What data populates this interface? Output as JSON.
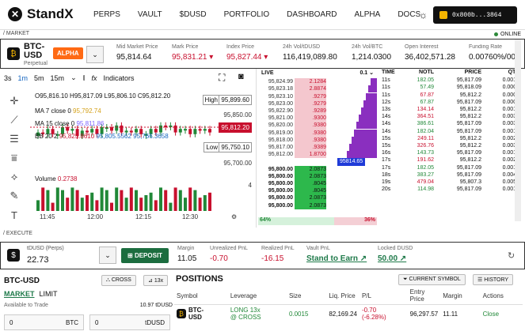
{
  "nav": {
    "logo": "StandX",
    "items": [
      "PERPS",
      "VAULT",
      "$DUSD",
      "PORTFOLIO",
      "DASHBOARD",
      "ALPHA",
      "DOCS"
    ],
    "wallet": "0x800b...3864"
  },
  "sections": {
    "market": "/ MARKET",
    "online": "ONLINE",
    "execute": "/ EXECUTE"
  },
  "ticker": {
    "symbol": "BTC-USD",
    "type": "Perpetual",
    "badge": "ALPHA",
    "stats": [
      {
        "k": "Mid Market Price",
        "v": "95,814.64"
      },
      {
        "k": "Mark Price",
        "v": "95,831.21 ▾"
      },
      {
        "k": "Index Price",
        "v": "95,827.44 ▾"
      },
      {
        "k": "24h Vol/tDUSD",
        "v": "116,419,089.80"
      },
      {
        "k": "24h Vol/BTC",
        "v": "1,214.0300"
      },
      {
        "k": "Open Interest",
        "v": "36,402,571.28"
      },
      {
        "k": "Funding Rate",
        "v": "0.00760%/00:"
      }
    ]
  },
  "chart": {
    "intervals": [
      "3s",
      "1m",
      "5m",
      "15m"
    ],
    "active": "1m",
    "indicators": "Indicators",
    "ohlc": "O95,816.10 H95,817.09 L95,806.10 C95,812.20",
    "ma7": "MA 7 close 0",
    "ma7v": "95,792.74",
    "ma15": "MA 15 close 0",
    "ma15v": "95,811.86",
    "bb": "BB 20 2",
    "bbv1": "95,825.8610",
    "bbv2": "95,805.5562",
    "bbv3": "95,766.3658",
    "volume": "Volume",
    "volv": "0.2738",
    "high": "High",
    "ticks": [
      "95,899.60",
      "95,850.00",
      "95,812.20",
      "95,750.10",
      "95,700.00",
      "4"
    ],
    "low": "Low",
    "times": [
      "11:45",
      "12:00",
      "12:15",
      "12:30"
    ]
  },
  "chart_data": {
    "type": "candlestick",
    "categories": [
      "11:45",
      "12:00",
      "12:15",
      "12:30"
    ],
    "ylim": [
      95700,
      95899.6
    ],
    "values": [
      95812.2,
      95816.1,
      95806.1,
      95817.09
    ],
    "volume_label": "Volume",
    "title": "",
    "xlabel": "",
    "ylabel": ""
  },
  "orderbook": {
    "header": "LIVE",
    "step": "0.1",
    "asks": [
      "95,824.99",
      "95,823.18",
      "95,823.10",
      "95,823.00",
      "95,822.90",
      "95,821.00",
      "95,820.00",
      "95,819.00",
      "95,818.00",
      "95,817.00",
      "95,812.00"
    ],
    "asksz": [
      "2.1284",
      "2.8874",
      ".9279",
      ".9279",
      ".9289",
      ".9300",
      ".9380",
      ".9380",
      ".9380",
      ".9389",
      "1.8700"
    ],
    "bids": [
      "95,800.00",
      "95,800.00",
      "95,800.00",
      "95,800.00",
      "95,800.00",
      "95,800.00"
    ],
    "bidsz": [
      "2.0873",
      "2.0873",
      ".8045",
      ".8045",
      "2.0873",
      "2.0873"
    ],
    "mid": "95814.65",
    "pct_left": "64%",
    "pct_right": "36%"
  },
  "trades": {
    "headers": [
      "TIME",
      "NOTL",
      "PRICE",
      "QTY"
    ],
    "rows": [
      [
        "11s",
        "182.05",
        "95,817.09",
        "0.0019"
      ],
      [
        "11s",
        "57.49",
        "95,818.09",
        "0.0006"
      ],
      [
        "11s",
        "67.87",
        "95,812.2",
        "0.0007"
      ],
      [
        "12s",
        "67.87",
        "95,817.09",
        "0.0007"
      ],
      [
        "13s",
        "134.14",
        "95,812.2",
        "0.0014"
      ],
      [
        "14s",
        "364.51",
        "95,812.2",
        "0.0038"
      ],
      [
        "14s",
        "386.61",
        "95,817.09",
        "0.0032"
      ],
      [
        "14s",
        "182.04",
        "95,817.09",
        "0.0019"
      ],
      [
        "15s",
        "249.11",
        "95,812.2",
        "0.0026"
      ],
      [
        "15s",
        "326.76",
        "95,812.2",
        "0.0034"
      ],
      [
        "16s",
        "143.73",
        "95,817.09",
        "0.0015"
      ],
      [
        "17s",
        "191.62",
        "95,812.2",
        "0.0020"
      ],
      [
        "17s",
        "182.05",
        "95,817.09",
        "0.0019"
      ],
      [
        "18s",
        "383.27",
        "95,817.09",
        "0.0040"
      ],
      [
        "19s",
        "479.04",
        "95,807.3",
        "0.0050"
      ],
      [
        "20s",
        "114.98",
        "95,817.09",
        "0.0012"
      ]
    ]
  },
  "balance": {
    "label": "tDUSD (Perps)",
    "value": "22.73",
    "deposit": "DEPOSIT",
    "items": [
      {
        "k": "Margin",
        "v": "11.05"
      },
      {
        "k": "Unrealized PnL",
        "v": "-0.70"
      },
      {
        "k": "Realized PnL",
        "v": "-16.15"
      },
      {
        "k": "Vault PnL",
        "v": "Stand to Earn"
      },
      {
        "k": "Locked DUSD",
        "v": "50.00"
      }
    ]
  },
  "order": {
    "symbol": "BTC-USD",
    "mode": "CROSS",
    "lev": "13x",
    "tabs": [
      "MARKET",
      "LIMIT"
    ],
    "avail": "Available to Trade",
    "availv": "10.97 tDUSD",
    "in1": "0",
    "in1u": "BTC",
    "in2": "0",
    "in2u": "tDUSD"
  },
  "positions": {
    "title": "POSITIONS",
    "btn1": "CURRENT SYMBOL",
    "btn2": "HISTORY",
    "headers": [
      "Symbol",
      "Leverage",
      "Size",
      "Liq. Price",
      "P/L",
      "Entry Price",
      "Margin",
      "Actions"
    ],
    "row": {
      "sym": "BTC-USD",
      "lev": "LONG 13x",
      "mode": "@ CROSS",
      "size": "0.0015",
      "liq": "82,169.24",
      "pl": "-0.70",
      "plpct": "(-6.28%)",
      "entry": "96,297.57",
      "margin": "11.11",
      "action": "Close"
    }
  }
}
